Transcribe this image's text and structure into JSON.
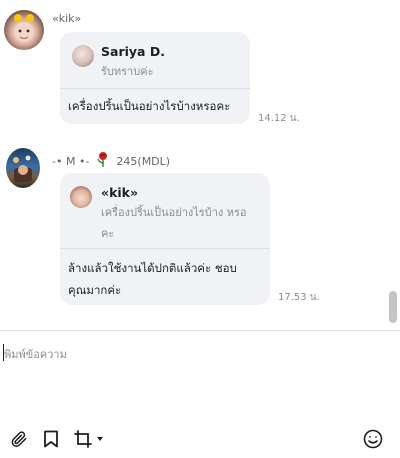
{
  "messages": [
    {
      "sender": "«kik»",
      "reply": {
        "name": "Sariya D.",
        "text": "รับทราบค่ะ"
      },
      "text": "เครื่องปริ้นเป็นอย่างไรบ้างหรอคะ",
      "time": "14.12 น."
    },
    {
      "sender": "-• M •-",
      "sender_suffix": "245(MDL)",
      "reply": {
        "name": "«kik»",
        "text": "เครื่องปริ้นเป็นอย่างไรบ้าง หรอคะ"
      },
      "text": "ล้างแล้วใช้งานได้ปกติแล้วค่ะ ชอบคุณมากค่ะ",
      "time": "17.53 น."
    }
  ],
  "composer": {
    "placeholder": "พิมพ์ข้อความ"
  },
  "toolbar": {
    "icons": [
      "paperclip-icon",
      "bookmark-icon",
      "crop-icon",
      "chevron-down-icon",
      "emoji-icon"
    ]
  },
  "colors": {
    "bubble": "#f0f2f5",
    "muted_text": "#8a8d91",
    "divider": "#e4e6eb"
  }
}
